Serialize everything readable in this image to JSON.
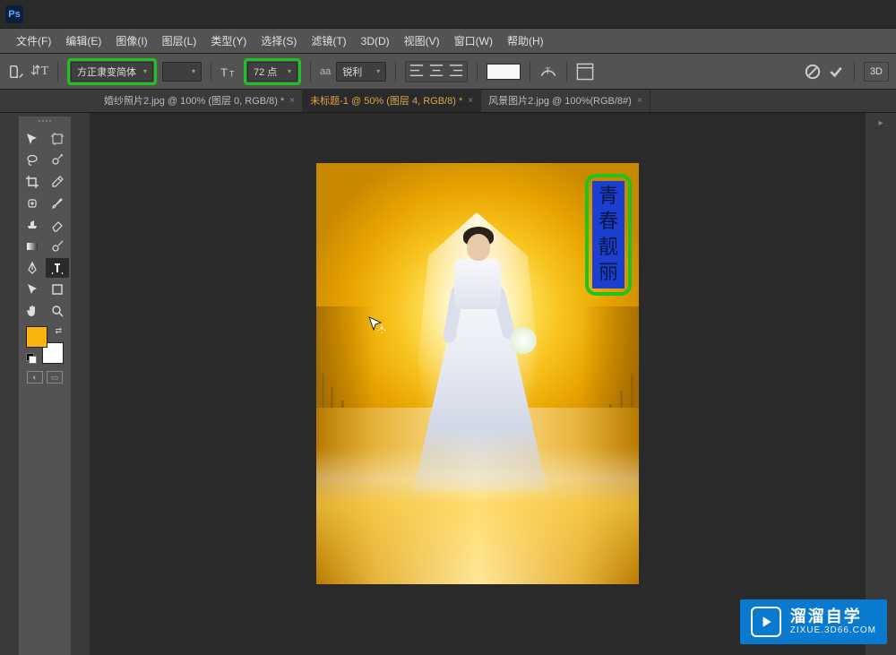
{
  "app": {
    "logo_text": "Ps"
  },
  "menu": {
    "items": [
      "文件(F)",
      "编辑(E)",
      "图像(I)",
      "图层(L)",
      "类型(Y)",
      "选择(S)",
      "滤镜(T)",
      "3D(D)",
      "视图(V)",
      "窗口(W)",
      "帮助(H)"
    ]
  },
  "options": {
    "font_family": "方正隶变简体",
    "font_size": "72 点",
    "aa_label": "aa",
    "antialias": "锐利",
    "text_color": "#f8f8f8",
    "btn_3d": "3D"
  },
  "tabs": [
    {
      "label": "婚纱照片2.jpg @ 100% (图层 0, RGB/8) *",
      "active": false
    },
    {
      "label": "未标题-1 @ 50% (图层 4, RGB/8) *",
      "active": true
    },
    {
      "label": "风景图片2.jpg @ 100%(RGB/8#)",
      "active": false
    }
  ],
  "canvas": {
    "vertical_text": [
      "青",
      "春",
      "靓",
      "丽"
    ],
    "text_bg": "#1c3fd1",
    "highlight_color": "#1ec41e"
  },
  "colors": {
    "foreground": "#f7b50e",
    "background": "#ffffff"
  },
  "watermark": {
    "cn": "溜溜自学",
    "url": "ZIXUE.3D66.COM"
  }
}
